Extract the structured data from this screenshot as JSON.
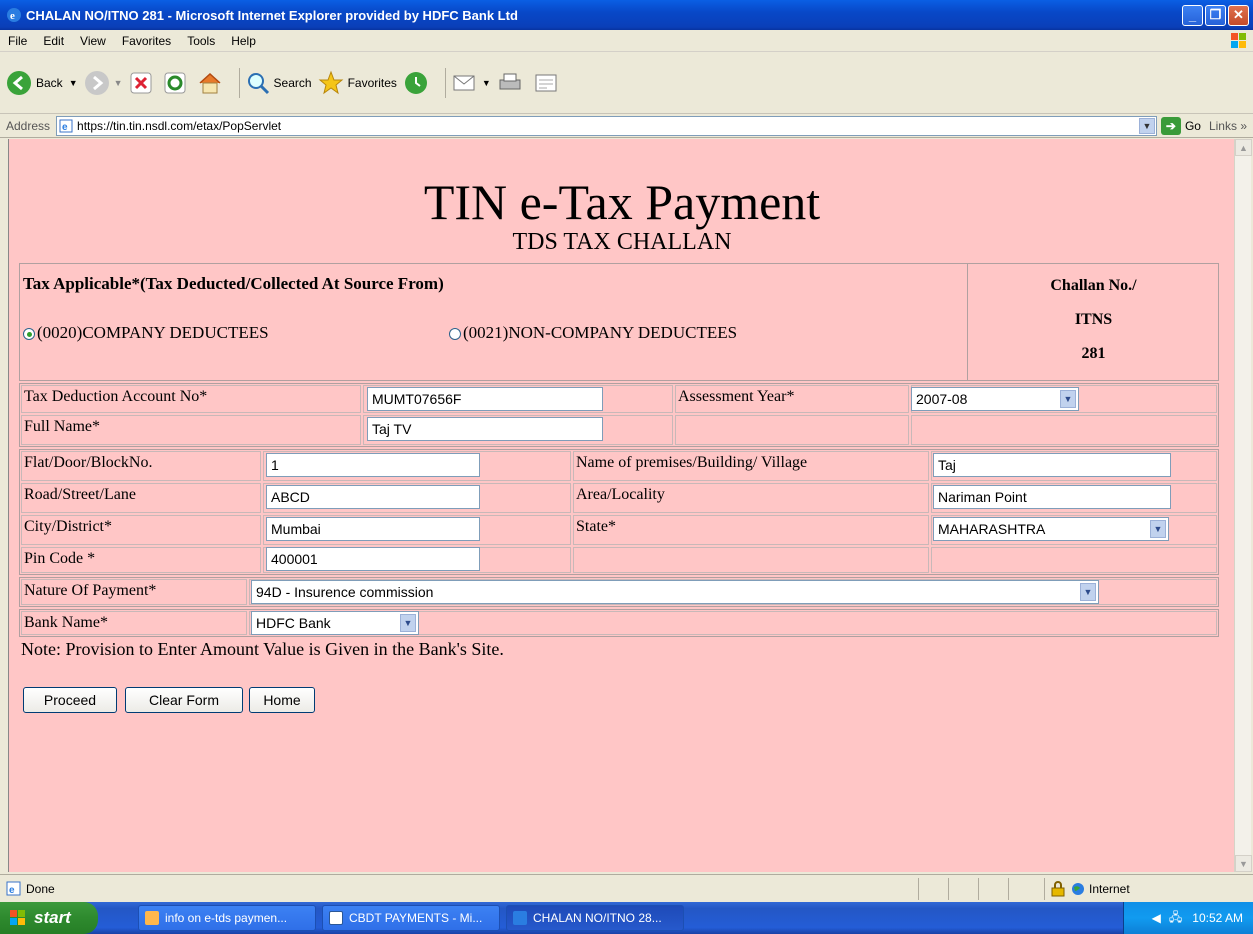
{
  "window": {
    "title": "CHALAN NO/ITNO 281 - Microsoft Internet Explorer provided by HDFC Bank Ltd"
  },
  "menu": [
    "File",
    "Edit",
    "View",
    "Favorites",
    "Tools",
    "Help"
  ],
  "toolbar": {
    "back": "Back",
    "search": "Search",
    "favorites": "Favorites"
  },
  "address": {
    "label": "Address",
    "url": "https://tin.tin.nsdl.com/etax/PopServlet",
    "go": "Go",
    "links": "Links"
  },
  "page": {
    "title": "TIN e-Tax Payment",
    "subtitle": "TDS TAX CHALLAN",
    "tax_applicable_label": "Tax Applicable*(Tax Deducted/Collected At Source From)",
    "option_company": "(0020)COMPANY DEDUCTEES",
    "option_noncompany": "(0021)NON-COMPANY DEDUCTEES",
    "challan_label": "Challan No./",
    "challan_itns": "ITNS",
    "challan_number": "281",
    "tan_label": "Tax Deduction Account No*",
    "tan_value": "MUMT07656F",
    "ay_label": "Assessment Year*",
    "ay_value": "2007-08",
    "fullname_label": "Full Name*",
    "fullname_value": "Taj TV",
    "flat_label": "Flat/Door/BlockNo.",
    "flat_value": "1",
    "premises_label": "Name of premises/Building/ Village",
    "premises_value": "Taj",
    "road_label": "Road/Street/Lane",
    "road_value": "ABCD",
    "area_label": "Area/Locality",
    "area_value": "Nariman Point",
    "city_label": "City/District*",
    "city_value": "Mumbai",
    "state_label": "State*",
    "state_value": "MAHARASHTRA",
    "pin_label": "Pin Code *",
    "pin_value": "400001",
    "nature_label": "Nature Of Payment*",
    "nature_value": "94D - Insurence commission",
    "bank_label": "Bank Name*",
    "bank_value": "HDFC Bank",
    "note": "Note: Provision to Enter Amount Value is Given in the Bank's Site.",
    "btn_proceed": "Proceed",
    "btn_clear": "Clear Form",
    "btn_home": "Home"
  },
  "status": {
    "left": "Done",
    "zone": "Internet"
  },
  "taskbar": {
    "start": "start",
    "tasks": [
      "info on e-tds paymen...",
      "CBDT PAYMENTS - Mi...",
      "CHALAN NO/ITNO 28..."
    ],
    "clock": "10:52 AM"
  }
}
